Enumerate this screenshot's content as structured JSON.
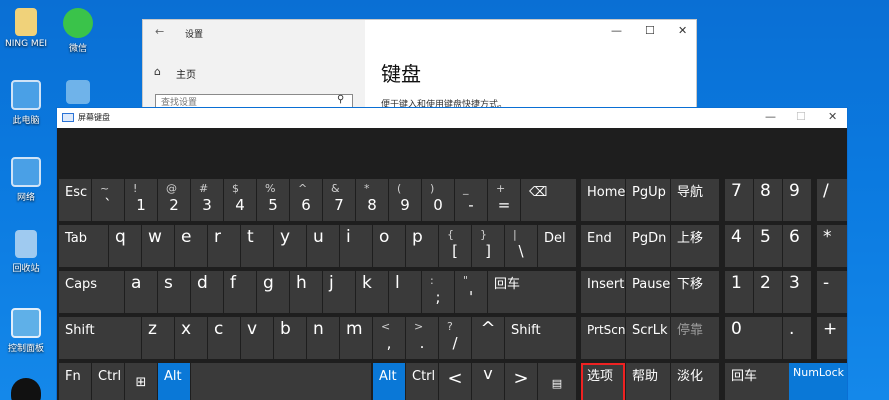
{
  "desktop": {
    "icons": [
      {
        "name": "ning-mei",
        "label": "NING MEI",
        "color": "#f0d27a"
      },
      {
        "name": "wechat",
        "label": "微信",
        "color": "#3ac34a"
      },
      {
        "name": "this-pc",
        "label": "此电脑",
        "color": "#4aa0e6"
      },
      {
        "name": "network",
        "label": "网络",
        "color": "#4aa0e6"
      },
      {
        "name": "recycle-bin",
        "label": "回收站",
        "color": "#9fcaf0"
      },
      {
        "name": "control-panel",
        "label": "控制面板",
        "color": "#5fb0e8"
      },
      {
        "name": "qq",
        "label": "",
        "color": "#111111"
      }
    ]
  },
  "settings": {
    "title": "设置",
    "home": "主页",
    "search_placeholder": "查找设置",
    "heading": "键盘",
    "description": "便于键入和使用键盘快捷方式。",
    "minimize": "—",
    "maximize": "☐",
    "close": "✕",
    "back": "←"
  },
  "osk": {
    "title": "屏幕键盘",
    "minimize": "—",
    "maximize": "☐",
    "close": "✕"
  },
  "keys": {
    "esc": "Esc",
    "tilde": {
      "top": "~",
      "bot": "`"
    },
    "d1": {
      "top": "!",
      "bot": "1"
    },
    "d2": {
      "top": "@",
      "bot": "2"
    },
    "d3": {
      "top": "#",
      "bot": "3"
    },
    "d4": {
      "top": "$",
      "bot": "4"
    },
    "d5": {
      "top": "%",
      "bot": "5"
    },
    "d6": {
      "top": "^",
      "bot": "6"
    },
    "d7": {
      "top": "&",
      "bot": "7"
    },
    "d8": {
      "top": "*",
      "bot": "8"
    },
    "d9": {
      "top": "(",
      "bot": "9"
    },
    "d0": {
      "top": ")",
      "bot": "0"
    },
    "minus": {
      "top": "_",
      "bot": "-"
    },
    "equal": {
      "top": "+",
      "bot": "="
    },
    "backspace": "⌫",
    "tab": "Tab",
    "q": "q",
    "w": "w",
    "e": "e",
    "r": "r",
    "t": "t",
    "y": "y",
    "u": "u",
    "i": "i",
    "o": "o",
    "p": "p",
    "lbracket": {
      "top": "{",
      "bot": "["
    },
    "rbracket": {
      "top": "}",
      "bot": "]"
    },
    "backslash": {
      "top": "|",
      "bot": "\\"
    },
    "del": "Del",
    "caps": "Caps",
    "a": "a",
    "s": "s",
    "d": "d",
    "f": "f",
    "g": "g",
    "h": "h",
    "j": "j",
    "k": "k",
    "l": "l",
    "semicolon": {
      "top": ":",
      "bot": ";"
    },
    "quote": {
      "top": "\"",
      "bot": "'"
    },
    "enter": "回车",
    "lshift": "Shift",
    "z": "z",
    "x": "x",
    "c": "c",
    "v": "v",
    "b": "b",
    "n": "n",
    "m": "m",
    "comma": {
      "top": "<",
      "bot": ","
    },
    "period": {
      "top": ">",
      "bot": "."
    },
    "slash": {
      "top": "?",
      "bot": "/"
    },
    "up": "^",
    "rshift": "Shift",
    "fn": "Fn",
    "lctrl": "Ctrl",
    "win": "⊞",
    "lalt": "Alt",
    "ralt": "Alt",
    "rctrl": "Ctrl",
    "left": "<",
    "down": "v",
    "right": ">",
    "menu": "▤",
    "home": "Home",
    "pgup": "PgUp",
    "nav": "导航",
    "end": "End",
    "pgdn": "PgDn",
    "moveup": "上移",
    "insert": "Insert",
    "pause": "Pause",
    "movedown": "下移",
    "prtscn": "PrtScn",
    "scrlk": "ScrLk",
    "dock": "停靠",
    "options": "选项",
    "help": "帮助",
    "fade": "淡化",
    "n7": "7",
    "n8": "8",
    "n9": "9",
    "ndiv": "/",
    "n4": "4",
    "n5": "5",
    "n6": "6",
    "nmul": "*",
    "n1": "1",
    "n2": "2",
    "n3": "3",
    "nsub": "-",
    "n0": "0",
    "ndot": ".",
    "nadd": "+",
    "nenter": "回车",
    "numlock": "NumLock"
  }
}
